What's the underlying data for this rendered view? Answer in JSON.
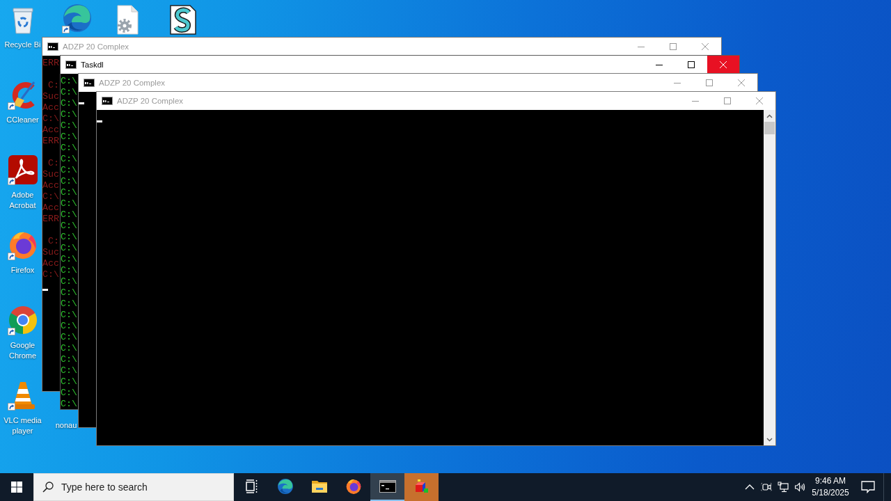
{
  "desktop": {
    "icons": [
      {
        "kind": "recycle-bin",
        "label": "Recycle Bi",
        "shortcut": false
      },
      {
        "kind": "edge",
        "shortcut": true
      },
      {
        "kind": "gear-file",
        "shortcut": false
      },
      {
        "kind": "script-file",
        "shortcut": false
      },
      {
        "kind": "ccleaner",
        "label": "CCleaner",
        "shortcut": true
      },
      {
        "kind": "acrobat",
        "label": "Adobe Acrobat",
        "shortcut": true
      },
      {
        "kind": "firefox",
        "label": "Firefox",
        "shortcut": true
      },
      {
        "kind": "chrome",
        "label": "Google Chrome",
        "shortcut": true
      },
      {
        "kind": "vlc",
        "label": "VLC media player",
        "shortcut": true
      },
      {
        "label": "nonau",
        "shortcut": false
      }
    ]
  },
  "windows": [
    {
      "title": "ADZP 20 Complex",
      "active": false,
      "close_hovered": false,
      "color": "#8b1c1c",
      "blocks": [
        [
          "ERR"
        ],
        [
          " C:",
          "Suc",
          "Acc",
          "C:\\",
          "Acc",
          "ERR"
        ],
        [
          " C:",
          "Suc",
          "Acc",
          "C:\\",
          "Acc",
          "ERR"
        ],
        [
          " C:",
          "Suc",
          "Acc",
          "C:\\"
        ]
      ],
      "cursor": true
    },
    {
      "title": "Taskdl",
      "active": true,
      "close_hovered": true,
      "color": "#2ec42e",
      "blocks": [
        [
          "C:\\",
          "C:\\",
          "C:\\",
          "C:\\",
          "C:\\",
          "C:\\",
          "C:\\",
          "C:\\",
          "C:\\",
          "C:\\",
          "C:\\",
          "C:\\",
          "C:\\",
          "C:\\",
          "C:\\",
          "C:\\",
          "C:\\",
          "C:\\",
          "C:\\",
          "C:\\",
          "C:\\",
          "C:\\",
          "C:\\",
          "C:\\",
          "C:\\",
          "C:\\",
          "C:\\",
          "C:\\",
          "C:\\",
          "C:\\"
        ]
      ]
    },
    {
      "title": "ADZP 20 Complex",
      "active": false,
      "close_hovered": false,
      "cursor": true
    },
    {
      "title": "ADZP 20 Complex",
      "active": false,
      "close_hovered": false,
      "cursor": true,
      "scrollbar": true
    }
  ],
  "taskbar": {
    "search": {
      "placeholder": "Type here to search"
    },
    "buttons": [
      {
        "kind": "task-view",
        "active": false,
        "flashing": false
      },
      {
        "kind": "edge",
        "active": false,
        "flashing": false
      },
      {
        "kind": "file-explorer",
        "active": false,
        "flashing": false
      },
      {
        "kind": "firefox",
        "active": false,
        "flashing": false
      },
      {
        "kind": "console",
        "active": true,
        "flashing": false
      },
      {
        "kind": "cube-app",
        "active": false,
        "flashing": true
      }
    ],
    "tray": [
      {
        "kind": "chevron"
      },
      {
        "kind": "camera"
      },
      {
        "kind": "network"
      },
      {
        "kind": "volume"
      }
    ],
    "clock": {
      "time": "9:46 AM",
      "date": "5/18/2025"
    }
  }
}
